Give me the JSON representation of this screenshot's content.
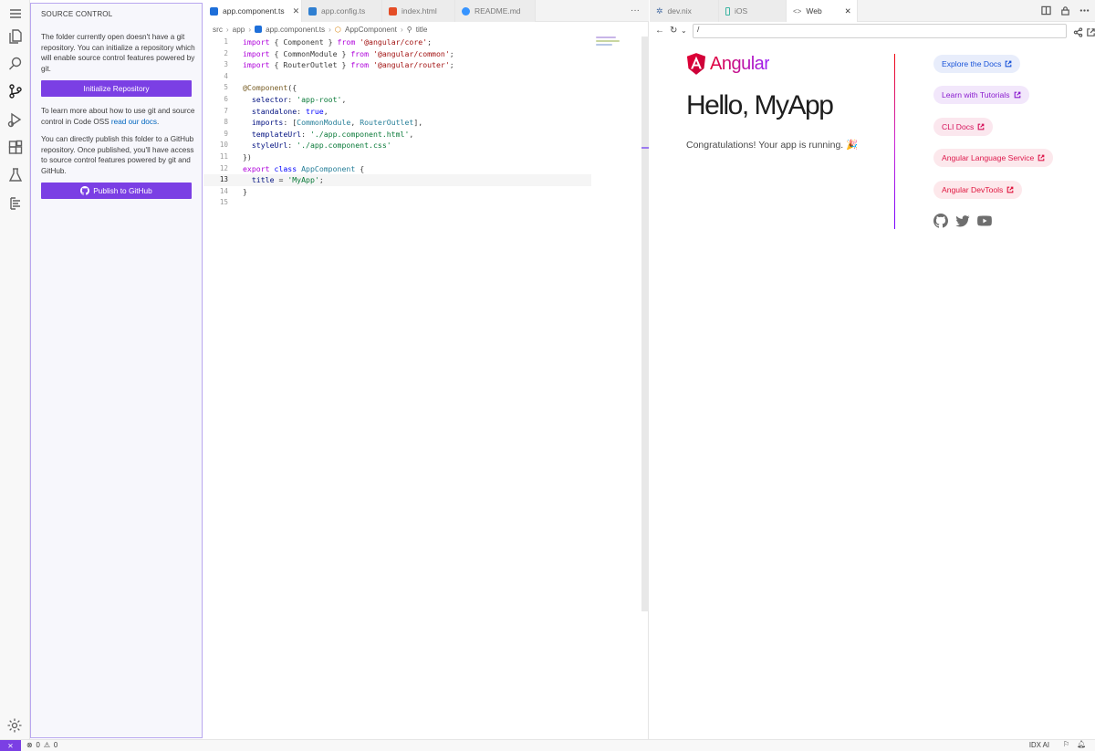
{
  "activity_bar": {
    "items": [
      "menu-icon",
      "explorer-icon",
      "search-icon",
      "source-control-icon",
      "run-debug-icon",
      "extensions-icon",
      "flask-icon",
      "outline-icon"
    ],
    "active": "source-control-icon"
  },
  "sidebar": {
    "title": "SOURCE CONTROL",
    "intro": "The folder currently open doesn't have a git repository. You can initialize a repository which will enable source control features powered by git.",
    "init_button": "Initialize Repository",
    "learn_prefix": "To learn more about how to use git and source control in Code OSS ",
    "learn_link": "read our docs",
    "learn_suffix": ".",
    "publish_text": "You can directly publish this folder to a GitHub repository. Once published, you'll have access to source control features powered by git and GitHub.",
    "publish_button": "Publish to GitHub"
  },
  "editor": {
    "tabs": [
      {
        "label": "app.component.ts",
        "active": true,
        "icon_color": "#1e6fd9"
      },
      {
        "label": "app.config.ts",
        "active": false,
        "icon_color": "#2f7fd1"
      },
      {
        "label": "index.html",
        "active": false,
        "icon_color": "#e44d26"
      },
      {
        "label": "README.md",
        "active": false,
        "icon_color": "#3794ff"
      }
    ],
    "more": "···",
    "breadcrumb": [
      "src",
      "app",
      "app.component.ts",
      "AppComponent",
      "title"
    ],
    "current_line": 13
  },
  "code_lines": [
    {
      "n": "1",
      "html": "<span class=\"kw\">import</span> { Component } <span class=\"kw\">from</span> <span class=\"str\">'@angular/core'</span>;"
    },
    {
      "n": "2",
      "html": "<span class=\"kw\">import</span> { CommonModule } <span class=\"kw\">from</span> <span class=\"str\">'@angular/common'</span>;"
    },
    {
      "n": "3",
      "html": "<span class=\"kw\">import</span> { RouterOutlet } <span class=\"kw\">from</span> <span class=\"str\">'@angular/router'</span>;"
    },
    {
      "n": "4",
      "html": ""
    },
    {
      "n": "5",
      "html": "<span class=\"dec\">@Component</span>({"
    },
    {
      "n": "6",
      "html": "  <span class=\"prop\">selector</span>: <span class=\"str2\">'app-root'</span>,"
    },
    {
      "n": "7",
      "html": "  <span class=\"prop\">standalone</span>: <span class=\"kw2\">true</span>,"
    },
    {
      "n": "8",
      "html": "  <span class=\"prop\">imports</span>: [<span class=\"typ\">CommonModule</span>, <span class=\"typ\">RouterOutlet</span>],"
    },
    {
      "n": "9",
      "html": "  <span class=\"prop\">templateUrl</span>: <span class=\"str2\">'./app.component.html'</span>,"
    },
    {
      "n": "10",
      "html": "  <span class=\"prop\">styleUrl</span>: <span class=\"str2\">'./app.component.css'</span>"
    },
    {
      "n": "11",
      "html": "})"
    },
    {
      "n": "12",
      "html": "<span class=\"kw\">export</span> <span class=\"kw2\">class</span> <span class=\"typ\">AppComponent</span> {"
    },
    {
      "n": "13",
      "html": "  <span class=\"prop\">title</span> = <span class=\"str2\">'MyApp'</span>;"
    },
    {
      "n": "14",
      "html": "}"
    },
    {
      "n": "15",
      "html": ""
    }
  ],
  "preview": {
    "tabs": [
      {
        "label": "dev.nix",
        "active": false
      },
      {
        "label": "iOS",
        "active": false
      },
      {
        "label": "Web",
        "active": true
      }
    ],
    "url": "/",
    "brand": "Angular",
    "heading": "Hello, MyApp",
    "congrats": "Congratulations! Your app is running. 🎉",
    "pills": [
      {
        "label": "Explore the Docs",
        "color": "#1a54d9",
        "bg": "#e8edfb"
      },
      {
        "label": "Learn with Tutorials",
        "color": "#8a1ccf",
        "bg": "#f2e7fb"
      },
      {
        "label": "CLI Docs",
        "color": "#d6145c",
        "bg": "#fbe7ee"
      },
      {
        "label": "Angular Language Service",
        "color": "#de1a4d",
        "bg": "#fce8ec"
      },
      {
        "label": "Angular DevTools",
        "color": "#e0163f",
        "bg": "#fde8eb"
      }
    ],
    "social": [
      "github-icon",
      "twitter-icon",
      "youtube-icon"
    ]
  },
  "statusbar": {
    "remote": "⨯",
    "errors": "0",
    "warnings": "0",
    "idx": "IDX AI"
  }
}
